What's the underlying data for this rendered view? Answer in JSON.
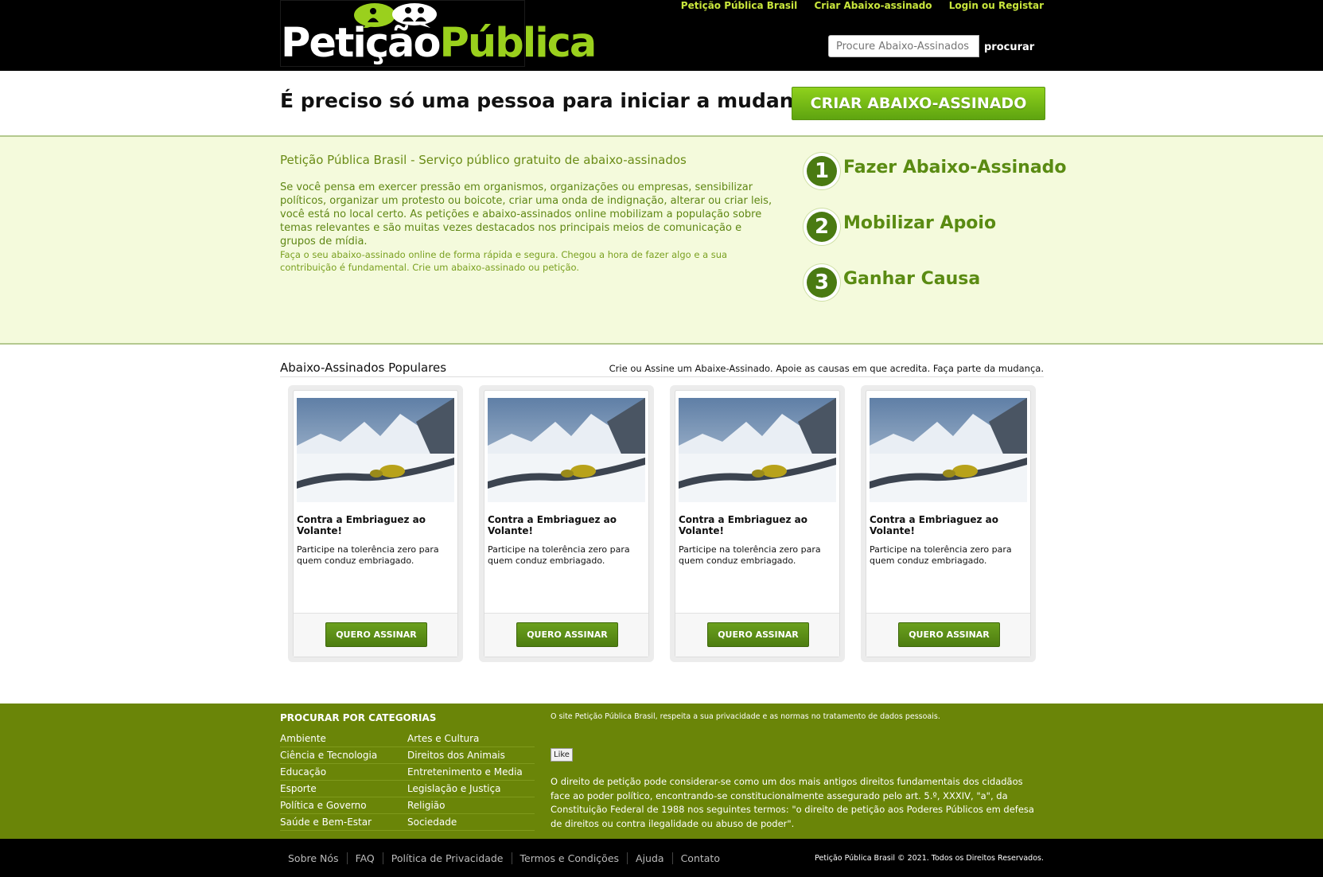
{
  "header": {
    "logo_white": "Petição",
    "logo_green": "Pública",
    "links": [
      "Petição Pública Brasil",
      "Criar Abaixo-assinado",
      "Login ou Registar"
    ],
    "search_placeholder": "Procure Abaixo-Assinados",
    "search_button": "procurar"
  },
  "hero": {
    "tagline": "É preciso só uma pessoa para iniciar a mudança.",
    "create_button": "CRIAR ABAIXO-ASSINADO"
  },
  "intro": {
    "title": "Petição Pública Brasil - Serviço público gratuito de abaixo-assinados",
    "paragraph1": "Se você pensa em exercer pressão em organismos, organizações ou empresas, sensibilizar políticos, organizar um protesto ou boicote, criar uma onda de indignação, alterar ou criar leis, você está no local certo. As petições e abaixo-assinados online mobilizam a população sobre temas relevantes e são muitas vezes destacados nos principais meios de comunicação e grupos de mídia.",
    "paragraph2": "Faça o seu abaixo-assinado online de forma rápida e segura. Chegou a hora de fazer algo e a sua contribuição é fundamental. Crie um abaixo-assinado ou petição.",
    "steps": [
      {
        "num": "1",
        "label": "Fazer Abaixo-Assinado"
      },
      {
        "num": "2",
        "label": "Mobilizar Apoio"
      },
      {
        "num": "3",
        "label": "Ganhar Causa"
      }
    ]
  },
  "popular": {
    "heading": "Abaixo-Assinados Populares",
    "subheading": "Crie ou Assine um Abaixe-Assinado. Apoie as causas em que acredita. Faça parte da mudança.",
    "cards": [
      {
        "title": "Contra a Embriaguez ao Volante!",
        "desc": "Participe na tolerência zero para quem conduz embriagado.",
        "button": "QUERO ASSINAR"
      },
      {
        "title": "Contra a Embriaguez ao Volante!",
        "desc": "Participe na tolerência zero para quem conduz embriagado.",
        "button": "QUERO ASSINAR"
      },
      {
        "title": "Contra a Embriaguez ao Volante!",
        "desc": "Participe na tolerência zero para quem conduz embriagado.",
        "button": "QUERO ASSINAR"
      },
      {
        "title": "Contra a Embriaguez ao Volante!",
        "desc": "Participe na tolerência zero para quem conduz embriagado.",
        "button": "QUERO ASSINAR"
      }
    ]
  },
  "footer": {
    "categories_title": "PROCURAR POR CATEGORIAS",
    "categories_left": [
      "Ambiente",
      "Ciência e Tecnologia",
      "Educação",
      "Esporte",
      "Política e Governo",
      "Saúde e Bem-Estar"
    ],
    "categories_right": [
      "Artes e Cultura",
      "Direitos dos Animais",
      "Entretenimento e Media",
      "Legislação e Justiça",
      "Religião",
      "Sociedade"
    ],
    "privacy_note": "O site Petição Pública Brasil, respeita a sua privacidade e as normas no tratamento de dados pessoais.",
    "like_button": "Like",
    "law_text": "O direito de petição pode considerar-se como um dos mais antigos direitos fundamentais dos cidadãos face ao poder político, encontrando-se constitucionalmente assegurado pelo art. 5.º, XXXIV, \"a\", da Constituição Federal de 1988 nos seguintes termos: \"o direito de petição aos Poderes Públicos em defesa de direitos ou contra ilegalidade ou abuso de poder\".",
    "bottom_links": [
      "Sobre Nós",
      "FAQ",
      "Política de Privacidade",
      "Termos e Condições",
      "Ajuda",
      "Contato"
    ],
    "copyright": "Petição Pública Brasil © 2021. Todos os Direitos Reservados."
  },
  "colors": {
    "brand_green": "#9ad01d",
    "dark_green": "#5a8b12",
    "footer_green": "#6a8508",
    "intro_bg": "#f4fadc"
  }
}
